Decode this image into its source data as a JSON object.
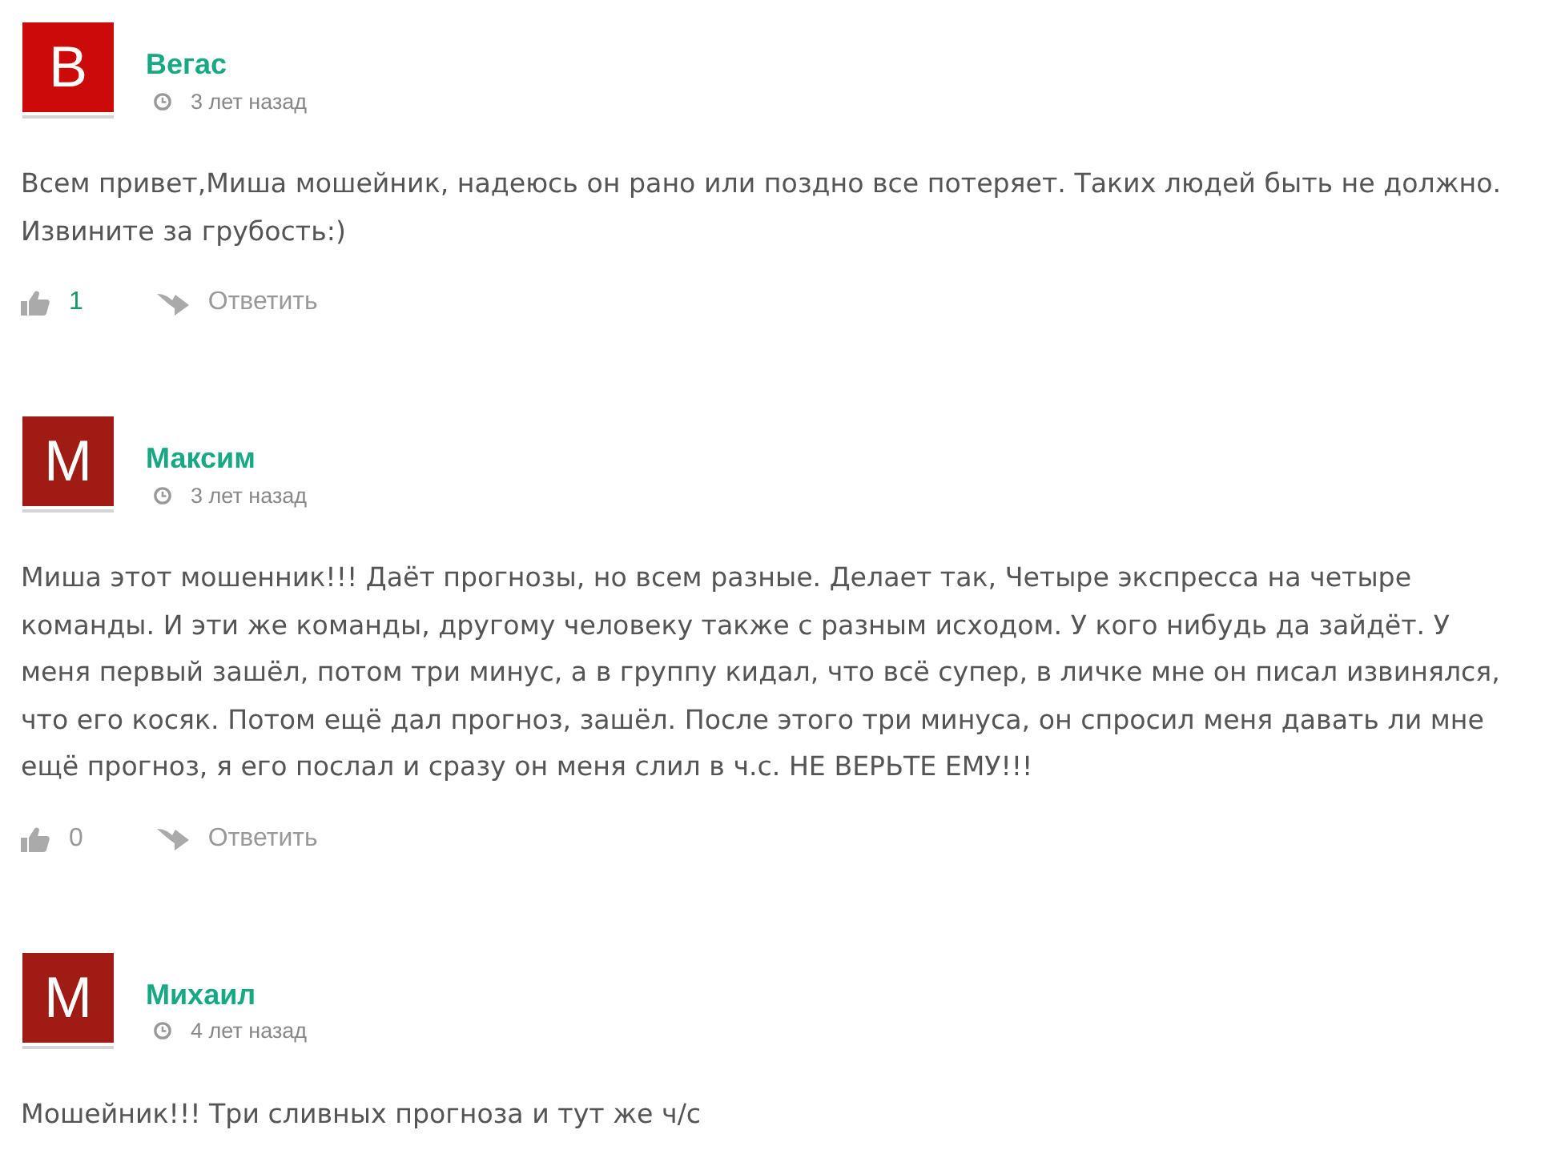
{
  "comments": [
    {
      "avatar_letter": "В",
      "color": "#cc0a0a",
      "author": "Вегас",
      "time": "3 лет назад",
      "text": "Всем привет,Миша мошейник, надеюсь он рано или поздно все потеряет. Таких людей быть не должно. Извините за грубость:)",
      "likes": "1",
      "highlighted": true,
      "reply_label": "Ответить"
    },
    {
      "avatar_letter": "М",
      "color": "#a01b13",
      "author": "Максим",
      "time": "3 лет назад",
      "text": "Миша этот мошенник!!! Даёт прогнозы, но всем разные. Делает так, Четыре экспресса на четыре команды. И эти же команды, другому человеку также с разным исходом. У кого нибудь да зайдёт. У меня первый зашёл, потом три минус, а в группу кидал, что всё супер, в личке мне он писал извинялся, что его косяк. Потом ещё дал прогноз, зашёл. После этого три минуса, он спросил меня давать ли мне ещё прогноз, я его послал и сразу он меня слил в ч.с. НЕ ВЕРЬТЕ ЕМУ!!!",
      "likes": "0",
      "highlighted": false,
      "reply_label": "Ответить"
    },
    {
      "avatar_letter": "М",
      "color": "#a01b13",
      "author": "Михаил",
      "time": "4 лет назад",
      "text": "Мошейник!!! Три сливных прогноза и тут же ч/с"
    }
  ]
}
